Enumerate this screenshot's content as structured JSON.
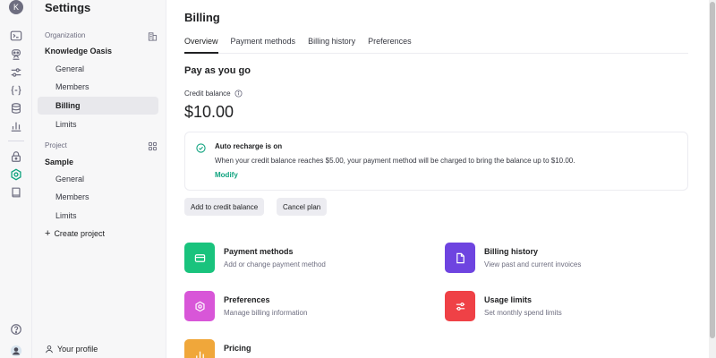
{
  "rail": {
    "avatar_initial": "K",
    "icons": [
      "terminal-icon",
      "assistant-icon",
      "sliders-icon",
      "braces-icon",
      "database-icon",
      "bar-chart-icon",
      "lock-icon",
      "gear-icon",
      "book-icon"
    ],
    "bottom_icons": [
      "help-icon",
      "user-avatar"
    ]
  },
  "sidebar": {
    "title": "Settings",
    "organization_label": "Organization",
    "organization_name": "Knowledge Oasis",
    "org_items": [
      {
        "label": "General"
      },
      {
        "label": "Members"
      },
      {
        "label": "Billing",
        "active": true
      },
      {
        "label": "Limits"
      }
    ],
    "project_label": "Project",
    "project_name": "Sample",
    "project_items": [
      {
        "label": "General"
      },
      {
        "label": "Members"
      },
      {
        "label": "Limits"
      }
    ],
    "create_project": "Create project",
    "profile": "Your profile"
  },
  "main": {
    "title": "Billing",
    "tabs": [
      {
        "label": "Overview",
        "active": true
      },
      {
        "label": "Payment methods"
      },
      {
        "label": "Billing history"
      },
      {
        "label": "Preferences"
      }
    ],
    "section_title": "Pay as you go",
    "credit_label": "Credit balance",
    "credit_value": "$10.00",
    "notice": {
      "title": "Auto recharge is on",
      "text": "When your credit balance reaches $5.00, your payment method will be charged to bring the balance up to $10.00.",
      "link": "Modify"
    },
    "buttons": {
      "add_credit": "Add to credit balance",
      "cancel_plan": "Cancel plan"
    },
    "cards": [
      {
        "title": "Payment methods",
        "desc": "Add or change payment method",
        "color": "#19c37d",
        "icon": "card-icon"
      },
      {
        "title": "Billing history",
        "desc": "View past and current invoices",
        "color": "#6e44e0",
        "icon": "document-icon"
      },
      {
        "title": "Preferences",
        "desc": "Manage billing information",
        "color": "#d856d8",
        "icon": "gear-icon"
      },
      {
        "title": "Usage limits",
        "desc": "Set monthly spend limits",
        "color": "#ef4146",
        "icon": "sliders-icon"
      },
      {
        "title": "Pricing",
        "desc": "",
        "color": "#f0a73a",
        "icon": "bar-chart-icon"
      }
    ]
  },
  "colors": {
    "accent": "#10a37f",
    "sidebar_bg": "#f7f7f8",
    "button_bg": "#ececf1"
  }
}
